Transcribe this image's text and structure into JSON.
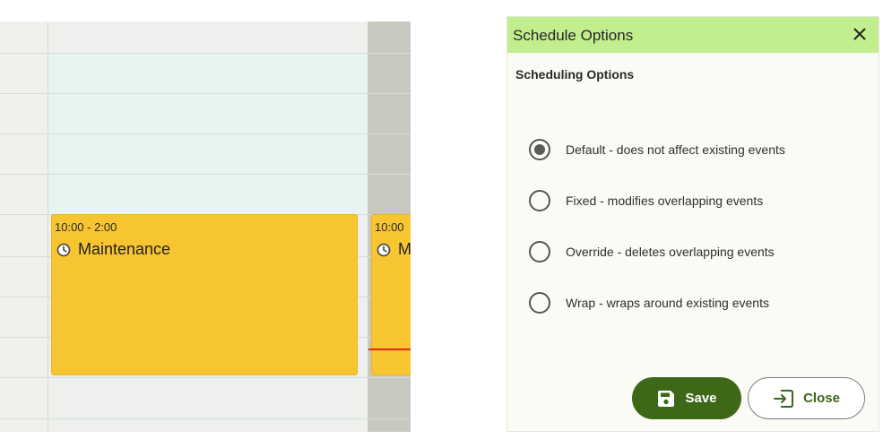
{
  "calendar": {
    "events": [
      {
        "time": "10:00 - 2:00",
        "title": "Maintenance"
      },
      {
        "time": "10:00",
        "title": "M"
      }
    ],
    "event_color": "#f6c531",
    "now_line_color": "#e02a1c",
    "event_icon": "clock-icon"
  },
  "dialog": {
    "title": "Schedule Options",
    "section_title": "Scheduling Options",
    "header_color": "#c3ee8d",
    "options": [
      {
        "label": "Default - does not affect existing events",
        "selected": true
      },
      {
        "label": "Fixed - modifies overlapping events",
        "selected": false
      },
      {
        "label": "Override - deletes overlapping events",
        "selected": false
      },
      {
        "label": "Wrap - wraps around existing events",
        "selected": false
      }
    ],
    "buttons": {
      "save_label": "Save",
      "close_label": "Close",
      "save_color": "#3e6718"
    },
    "icons": {
      "close": "close-icon",
      "save": "save-icon",
      "exit": "exit-icon"
    }
  }
}
